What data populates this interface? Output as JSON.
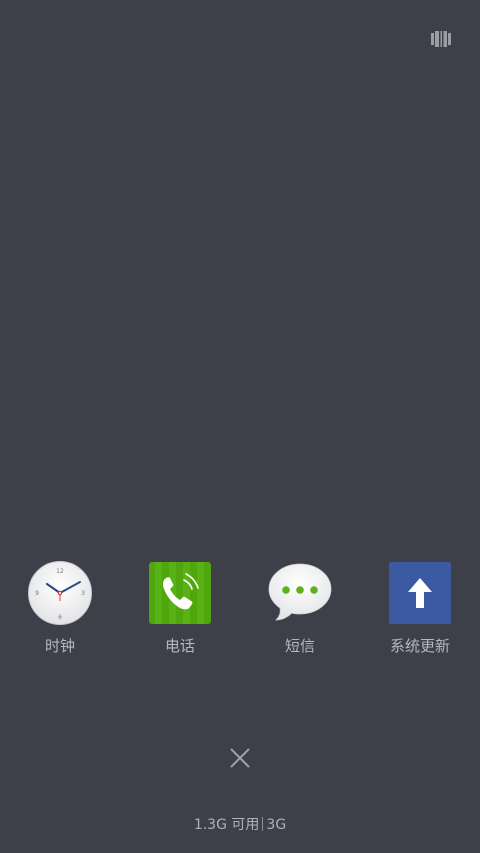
{
  "top_bar": {
    "icon": "task-list-icon"
  },
  "recent_apps": [
    {
      "label": "时钟",
      "icon": "clock-icon"
    },
    {
      "label": "电话",
      "icon": "phone-icon"
    },
    {
      "label": "短信",
      "icon": "messages-icon"
    },
    {
      "label": "系统更新",
      "icon": "update-icon"
    }
  ],
  "close_button": {
    "icon": "close-icon"
  },
  "memory": {
    "available": "1.3G 可用",
    "total": "3G"
  },
  "colors": {
    "background": "#3d4048",
    "phone_green": "#4fa60d",
    "update_blue": "#3b5aa3",
    "message_dot_green": "#5db21c"
  }
}
